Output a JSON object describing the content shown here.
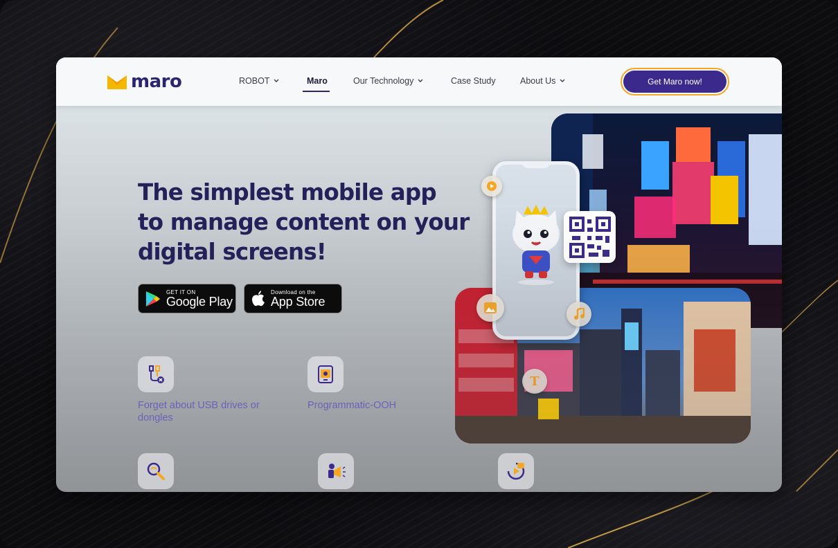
{
  "brand": {
    "name": "maro",
    "accent": "#3b2a8c",
    "logo_yellow": "#f5a623"
  },
  "nav": {
    "items": [
      {
        "label": "ROBOT",
        "dropdown": true
      },
      {
        "label": "Maro",
        "dropdown": false,
        "active": true
      },
      {
        "label": "Our Technology",
        "dropdown": true
      },
      {
        "label": "Case Study",
        "dropdown": false
      },
      {
        "label": "About Us",
        "dropdown": true
      }
    ],
    "cta_label": "Get Maro now!"
  },
  "hero": {
    "title_lines": [
      "The simplest mobile app",
      "to manage content on your",
      "digital screens!"
    ],
    "google_play": {
      "small": "GET IT ON",
      "big": "Google Play"
    },
    "app_store": {
      "small": "Download on the",
      "big": "App Store"
    }
  },
  "features": [
    {
      "label": "Forget about USB drives or dongles",
      "icon": "usb-icon"
    },
    {
      "label": "Programmatic-OOH",
      "icon": "screen-settings-icon"
    },
    {
      "label": "",
      "icon": "magnifier-icon"
    },
    {
      "label": "",
      "icon": "megaphone-icon"
    },
    {
      "label": "",
      "icon": "video-play-icon"
    }
  ],
  "decor_icons": [
    "play-circle-icon",
    "image-icon",
    "music-note-icon",
    "text-t-icon",
    "qr-code-icon"
  ]
}
